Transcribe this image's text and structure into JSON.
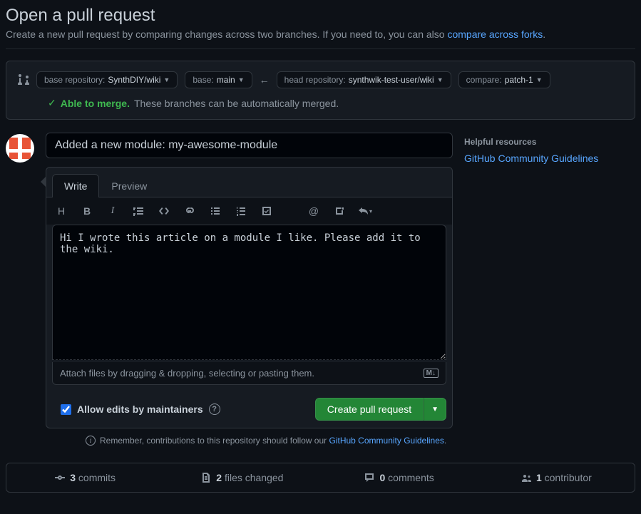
{
  "header": {
    "title": "Open a pull request",
    "subtitle_prefix": "Create a new pull request by comparing changes across two branches. If you need to, you can also ",
    "subtitle_link": "compare across forks",
    "subtitle_suffix": "."
  },
  "branches": {
    "base_repo_label": "base repository: ",
    "base_repo_value": "SynthDIY/wiki",
    "base_label": "base: ",
    "base_value": "main",
    "head_repo_label": "head repository: ",
    "head_repo_value": "synthwik-test-user/wiki",
    "compare_label": "compare: ",
    "compare_value": "patch-1"
  },
  "merge": {
    "able": "Able to merge.",
    "detail": "These branches can be automatically merged."
  },
  "form": {
    "title_value": "Added a new module: my-awesome-module",
    "tabs": {
      "write": "Write",
      "preview": "Preview"
    },
    "body_value": "Hi I wrote this article on a module I like. Please add it to the wiki.",
    "attach_hint": "Attach files by dragging & dropping, selecting or pasting them.",
    "allow_edits_label": "Allow edits by maintainers",
    "allow_edits_checked": true,
    "create_button": "Create pull request"
  },
  "remember": {
    "prefix": "Remember, contributions to this repository should follow our ",
    "link": "GitHub Community Guidelines",
    "suffix": "."
  },
  "sidebar": {
    "heading": "Helpful resources",
    "link": "GitHub Community Guidelines"
  },
  "summary": {
    "commits_count": "3",
    "commits_label": " commits",
    "files_count": "2",
    "files_label": " files changed",
    "comments_count": "0",
    "comments_label": " comments",
    "contributors_count": "1",
    "contributors_label": " contributor"
  },
  "md_badge": "M↓"
}
